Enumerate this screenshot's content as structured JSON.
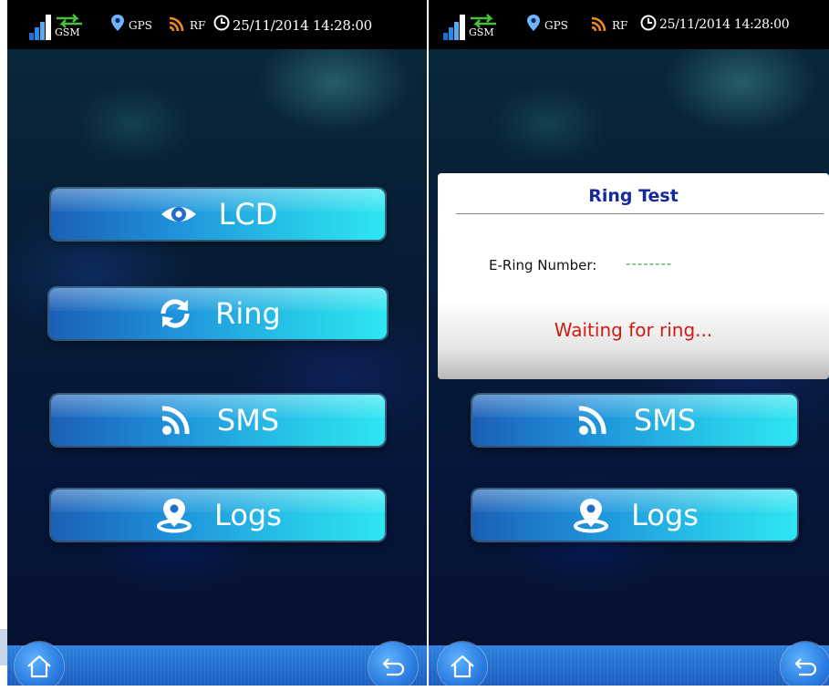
{
  "status_bar": {
    "network_label": "GSM",
    "gps_label": "GPS",
    "rf_label": "RF",
    "datetime": "25/11/2014 14:28:00"
  },
  "left_screen": {
    "menu": [
      {
        "label": "LCD",
        "icon": "eye-icon"
      },
      {
        "label": "Ring",
        "icon": "refresh-icon"
      },
      {
        "label": "SMS",
        "icon": "rss-icon"
      },
      {
        "label": "Logs",
        "icon": "location-pin-icon"
      }
    ]
  },
  "right_screen": {
    "dialog": {
      "title": "Ring Test",
      "field_label": "E-Ring Number:",
      "field_value": "--------",
      "status": "Waiting for ring..."
    },
    "menu": [
      {
        "label": "SMS",
        "icon": "rss-icon"
      },
      {
        "label": "Logs",
        "icon": "location-pin-icon"
      }
    ]
  },
  "nav_bar": {
    "home_icon": "home-icon",
    "back_icon": "back-arrow-icon"
  },
  "colors": {
    "dialog_title": "#162aa0",
    "status_text": "#d11a14",
    "field_value": "#3aa85a",
    "button_gradient_start": "#1b5fb6",
    "button_gradient_end": "#2ee6f2"
  }
}
